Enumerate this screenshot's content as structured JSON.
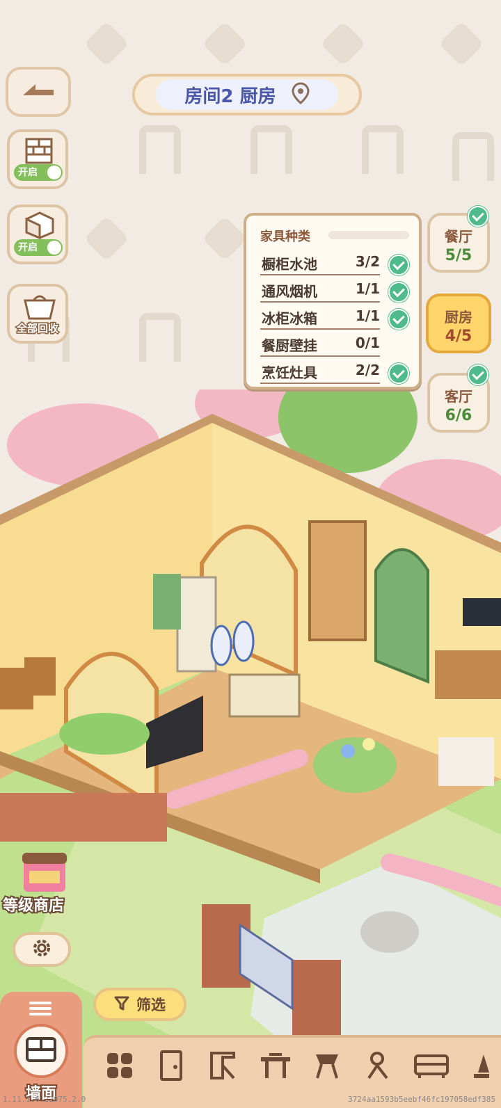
{
  "header": {
    "title": "房间2 厨房",
    "location_icon": "map-pin-icon"
  },
  "left_toolbar": {
    "back_icon": "back-arrow-icon",
    "wall_toggle": {
      "icon": "brick-wall-icon",
      "label": "开启",
      "on": true
    },
    "floor_toggle": {
      "icon": "cube-floor-icon",
      "label": "开启",
      "on": true
    },
    "recycle": {
      "icon": "basket-icon",
      "label": "全部回收"
    }
  },
  "furniture_panel": {
    "title": "家具种类",
    "items": [
      {
        "name": "橱柜水池",
        "count": "3/2",
        "done": true
      },
      {
        "name": "通风烟机",
        "count": "1/1",
        "done": true
      },
      {
        "name": "冰柜冰箱",
        "count": "1/1",
        "done": true
      },
      {
        "name": "餐厨壁挂",
        "count": "0/1",
        "done": false
      },
      {
        "name": "烹饪灶具",
        "count": "2/2",
        "done": true
      }
    ]
  },
  "room_tabs": [
    {
      "name": "餐厅",
      "count": "5/5",
      "done": true,
      "active": false
    },
    {
      "name": "厨房",
      "count": "4/5",
      "done": false,
      "active": true
    },
    {
      "name": "客厅",
      "count": "6/6",
      "done": true,
      "active": false
    }
  ],
  "level_shop": {
    "label": "等级商店"
  },
  "settings": {
    "icon": "gear-icon"
  },
  "filter": {
    "label": "筛选",
    "icon": "funnel-icon"
  },
  "wall_tab": {
    "label": "墙面",
    "icon": "wall-icon",
    "menu_icon": "list-icon"
  },
  "bottom_categories": [
    "grid-icon",
    "door-icon",
    "wall-frame-icon",
    "table-icon",
    "plant-stand-icon",
    "person-icon",
    "cabinet-icon",
    "lamp-icon"
  ],
  "footer": {
    "version": "1.11.1.6.22075.2.0",
    "hash": "3724aa1593b5eebf46fc197058edf385"
  },
  "colors": {
    "accent": "#ffd46a",
    "check": "#4fba8b",
    "title_text": "#4a56a6",
    "panel_border": "#cfae8a"
  }
}
